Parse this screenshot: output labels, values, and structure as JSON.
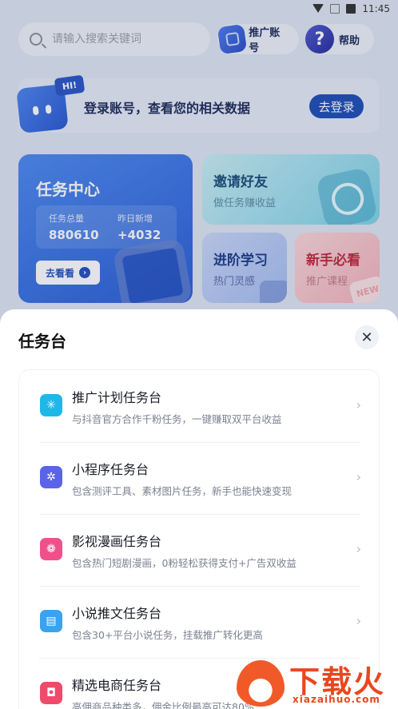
{
  "status_bar": {
    "time": "11:45"
  },
  "header": {
    "search_placeholder": "请输入搜索关键词",
    "promo_account_label": "推广账号",
    "help_label": "帮助"
  },
  "login_banner": {
    "badge": "HI!",
    "text": "登录账号，查看您的相关数据",
    "button": "去登录"
  },
  "task_center": {
    "title": "任务中心",
    "total_label": "任务总量",
    "total_value": "880610",
    "new_label": "昨日新增",
    "new_value": "+4032",
    "button": "去看看"
  },
  "invite_card": {
    "title": "邀请好友",
    "subtitle": "做任务赚收益"
  },
  "learn_card": {
    "title": "进阶学习",
    "subtitle": "热门灵感"
  },
  "newbie_card": {
    "title": "新手必看",
    "subtitle": "推广课程",
    "deco": "NEW"
  },
  "sheet": {
    "title": "任务台",
    "items": [
      {
        "title": "推广计划任务台",
        "desc": "与抖音官方合作千粉任务，一键赚取双平台收益",
        "icon": "sparkle-icon",
        "color": "#1fb8e6"
      },
      {
        "title": "小程序任务台",
        "desc": "包含测评工具、素材图片任务，新手也能快速变现",
        "icon": "asterisk-icon",
        "color": "#5b63e8"
      },
      {
        "title": "影视漫画任务台",
        "desc": "包含热门短剧漫画，0粉轻松获得支付+广告双收益",
        "icon": "film-reel-icon",
        "color": "#f0508a"
      },
      {
        "title": "小说推文任务台",
        "desc": "包含30+平台小说任务，挂载推广转化更高",
        "icon": "book-icon",
        "color": "#3aa2f0"
      },
      {
        "title": "精选电商任务台",
        "desc": "高佣商品种类多，佣金比例最高可达80%",
        "icon": "shopping-bag-icon",
        "color": "#f04a6a"
      }
    ]
  },
  "watermark": {
    "text": "下载火",
    "url": "xiazaihuo.com"
  }
}
